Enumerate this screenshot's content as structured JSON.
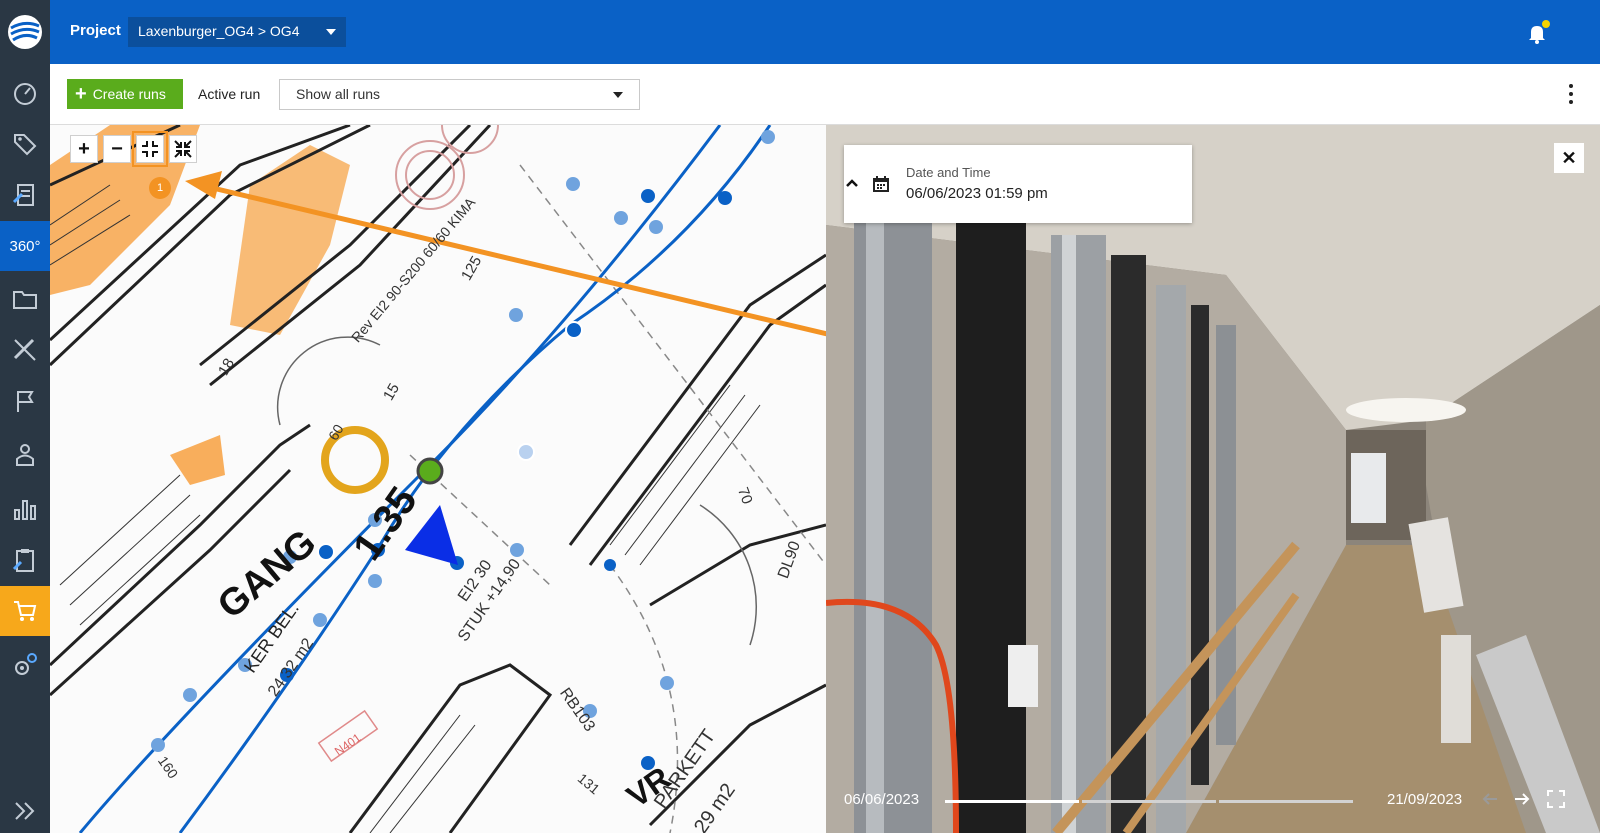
{
  "header": {
    "project_label": "Project",
    "project_value": "Laxenburger_OG4 > OG4"
  },
  "toolbar": {
    "create_label": "Create runs",
    "active_run_label": "Active run",
    "run_select_value": "Show all runs"
  },
  "sidebar": {
    "items": [
      {
        "icon": "gauge-icon"
      },
      {
        "icon": "tags-icon"
      },
      {
        "icon": "document-edit-icon"
      },
      {
        "icon": "360-icon",
        "label": "360°"
      },
      {
        "icon": "folder-icon"
      },
      {
        "icon": "ruler-pencil-icon"
      },
      {
        "icon": "flag-icon"
      },
      {
        "icon": "person-icon"
      },
      {
        "icon": "bar-chart-icon"
      },
      {
        "icon": "clipboard-icon"
      },
      {
        "icon": "cart-icon"
      },
      {
        "icon": "settings-gears-icon"
      },
      {
        "icon": "double-chevron-right-icon"
      }
    ]
  },
  "map": {
    "badge_number": "1",
    "plan_labels": [
      "GANG",
      "1.35",
      "VR",
      "PARKETT",
      "29 m2",
      "KER BEL.",
      "24 32 m2",
      "EI2 30",
      "STUK +14,90",
      "RB103",
      "DL90",
      "70",
      "125",
      "15",
      "18",
      "60",
      "160",
      "131",
      "N401",
      "Rev EI2 90-S200 60/60 KIMA"
    ]
  },
  "viewer": {
    "date_label": "Date and Time",
    "date_value": "06/06/2023 01:59 pm",
    "timeline_start": "06/06/2023",
    "timeline_end": "21/09/2023"
  },
  "colors": {
    "brand_blue": "#0a61c6",
    "sidebar": "#2a3744",
    "create_green": "#5aac1c",
    "highlight_orange": "#f39323",
    "sidebar_active_orange": "#f7a81b"
  }
}
